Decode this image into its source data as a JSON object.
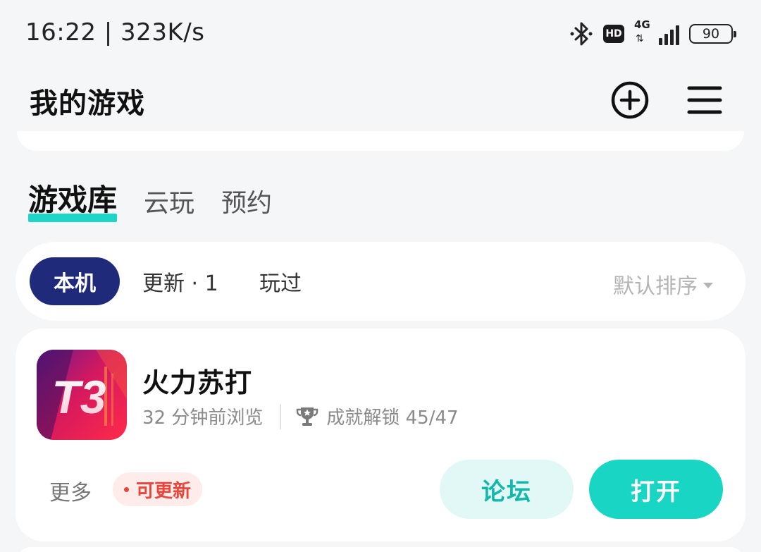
{
  "status_bar": {
    "time_speed": "16:22 | 323K/s",
    "hd_label": "HD",
    "network_label": "4G",
    "battery": "90"
  },
  "header": {
    "title": "我的游戏",
    "add_icon": "plus-circle-icon",
    "menu_icon": "hamburger-menu-icon"
  },
  "tabs": [
    {
      "label": "游戏库",
      "active": true
    },
    {
      "label": "云玩",
      "active": false
    },
    {
      "label": "预约",
      "active": false
    }
  ],
  "filters": {
    "local": "本机",
    "updates": "更新 · 1",
    "played": "玩过",
    "sort": "默认排序"
  },
  "game": {
    "icon_text": "T3",
    "name": "火力苏打",
    "last_viewed": "32 分钟前浏览",
    "achievements": "成就解锁 45/47",
    "more": "更多",
    "update_badge": "可更新",
    "forum_button": "论坛",
    "open_button": "打开"
  },
  "colors": {
    "accent": "#18d5c4",
    "active_chip": "#1f2a7a",
    "badge_red": "#e8453c"
  }
}
